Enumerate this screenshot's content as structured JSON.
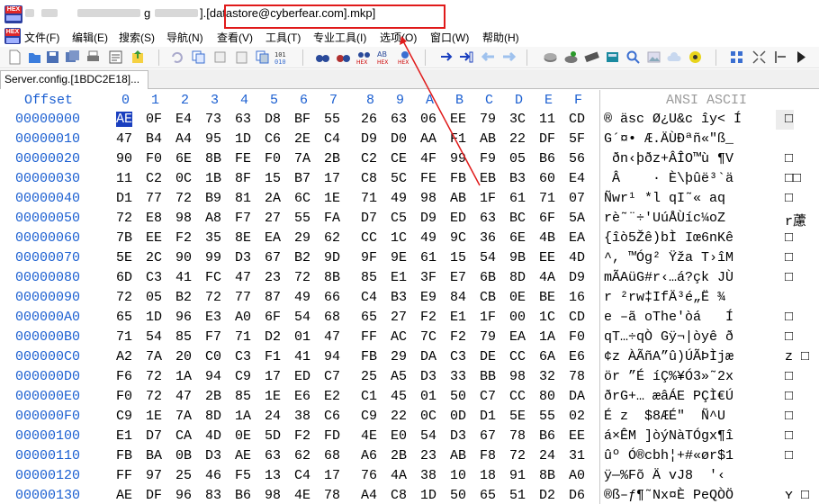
{
  "window": {
    "title_prefix": "g",
    "title_suffix": "].[datastore@cyberfear.com].mkp]",
    "title_bracket": "[",
    "icon": "hex-editor-app-icon"
  },
  "menu": [
    "文件(F)",
    "编辑(E)",
    "搜索(S)",
    "导航(N)",
    "查看(V)",
    "工具(T)",
    "专业工具(I)",
    "选项(O)",
    "窗口(W)",
    "帮助(H)"
  ],
  "toolbar": {
    "icons": [
      "new-file-icon",
      "open-file-icon",
      "save-icon",
      "save-all-icon",
      "print-icon",
      "properties-icon",
      "export-icon",
      "undo-icon",
      "copy-icon",
      "cut-icon",
      "paste-icon",
      "paste-special-icon",
      "bin-icon",
      "find-icon",
      "find-replace-icon",
      "find-hex-icon",
      "replace-hex-icon",
      "find-next-hex-icon",
      "goto-icon",
      "goto-offset-icon",
      "back-icon",
      "forward-icon",
      "disk-icon",
      "disk-open-icon",
      "ram-icon",
      "calculator-icon",
      "search-zoom-icon",
      "image-icon",
      "cloud-icon",
      "settings-gear-icon",
      "tools-icon",
      "run-icon"
    ],
    "accent": "#1b5fd1"
  },
  "tab": {
    "label": "Server.config.[1BDC2E18]..."
  },
  "editor": {
    "offset_header": "Offset",
    "columns": [
      "0",
      "1",
      "2",
      "3",
      "4",
      "5",
      "6",
      "7",
      "8",
      "9",
      "A",
      "B",
      "C",
      "D",
      "E",
      "F"
    ],
    "ansi_header": "ANSI ASCII",
    "rows": [
      {
        "off": "00000000",
        "bytes": [
          "AE",
          "0F",
          "E4",
          "73",
          "63",
          "D8",
          "BF",
          "55",
          "26",
          "63",
          "06",
          "EE",
          "79",
          "3C",
          "11",
          "CD"
        ],
        "ascii": "® äsc Ø¿U&c îy< Í",
        "pad": "□"
      },
      {
        "off": "00000010",
        "bytes": [
          "47",
          "B4",
          "A4",
          "95",
          "1D",
          "C6",
          "2E",
          "C4",
          "D9",
          "D0",
          "AA",
          "F1",
          "AB",
          "22",
          "DF",
          "5F"
        ],
        "ascii": "G´¤• Æ.ÄÙÐªñ«\"ß_",
        "pad": ""
      },
      {
        "off": "00000020",
        "bytes": [
          "90",
          "F0",
          "6E",
          "8B",
          "FE",
          "F0",
          "7A",
          "2B",
          "C2",
          "CE",
          "4F",
          "99",
          "F9",
          "05",
          "B6",
          "56"
        ],
        "ascii": " ðn‹þðz+ÂÎO™ù ¶V",
        "pad": "□"
      },
      {
        "off": "00000030",
        "bytes": [
          "11",
          "C2",
          "0C",
          "1B",
          "8F",
          "15",
          "B7",
          "17",
          "C8",
          "5C",
          "FE",
          "FB",
          "EB",
          "B3",
          "60",
          "E4"
        ],
        "ascii": " Â    · È\\þûë³`ä",
        "pad": "□□"
      },
      {
        "off": "00000040",
        "bytes": [
          "D1",
          "77",
          "72",
          "B9",
          "81",
          "2A",
          "6C",
          "1E",
          "71",
          "49",
          "98",
          "AB",
          "1F",
          "61",
          "71",
          "07"
        ],
        "ascii": "Ñwr¹ *l qI˜« aq",
        "pad": "□"
      },
      {
        "off": "00000050",
        "bytes": [
          "72",
          "E8",
          "98",
          "A8",
          "F7",
          "27",
          "55",
          "FA",
          "D7",
          "C5",
          "D9",
          "ED",
          "63",
          "BC",
          "6F",
          "5A"
        ],
        "ascii": "rè˜¨÷'UúÅÙíc¼oZ",
        "pad": "r藘"
      },
      {
        "off": "00000060",
        "bytes": [
          "7B",
          "EE",
          "F2",
          "35",
          "8E",
          "EA",
          "29",
          "62",
          "CC",
          "1C",
          "49",
          "9C",
          "36",
          "6E",
          "4B",
          "EA"
        ],
        "ascii": "{îò5Žê)bÌ Iœ6nKê",
        "pad": "□"
      },
      {
        "off": "00000070",
        "bytes": [
          "5E",
          "2C",
          "90",
          "99",
          "D3",
          "67",
          "B2",
          "9D",
          "9F",
          "9E",
          "61",
          "15",
          "54",
          "9B",
          "EE",
          "4D"
        ],
        "ascii": "^, ™Óg² Ÿža T›îM",
        "pad": "□"
      },
      {
        "off": "00000080",
        "bytes": [
          "6D",
          "C3",
          "41",
          "FC",
          "47",
          "23",
          "72",
          "8B",
          "85",
          "E1",
          "3F",
          "E7",
          "6B",
          "8D",
          "4A",
          "D9"
        ],
        "ascii": "mÃAüG#r‹…á?çk JÙ",
        "pad": "□"
      },
      {
        "off": "00000090",
        "bytes": [
          "72",
          "05",
          "B2",
          "72",
          "77",
          "87",
          "49",
          "66",
          "C4",
          "B3",
          "E9",
          "84",
          "CB",
          "0E",
          "BE",
          "16"
        ],
        "ascii": "r ²rw‡IfÄ³é„Ë ¾",
        "pad": ""
      },
      {
        "off": "000000A0",
        "bytes": [
          "65",
          "1D",
          "96",
          "E3",
          "A0",
          "6F",
          "54",
          "68",
          "65",
          "27",
          "F2",
          "E1",
          "1F",
          "00",
          "1C",
          "CD"
        ],
        "ascii": "e –ã oThe'òá   Í",
        "pad": "□"
      },
      {
        "off": "000000B0",
        "bytes": [
          "71",
          "54",
          "85",
          "F7",
          "71",
          "D2",
          "01",
          "47",
          "FF",
          "AC",
          "7C",
          "F2",
          "79",
          "EA",
          "1A",
          "F0"
        ],
        "ascii": "qT…÷qÒ Gÿ¬|òyê ð",
        "pad": "□"
      },
      {
        "off": "000000C0",
        "bytes": [
          "A2",
          "7A",
          "20",
          "C0",
          "C3",
          "F1",
          "41",
          "94",
          "FB",
          "29",
          "DA",
          "C3",
          "DE",
          "CC",
          "6A",
          "E6"
        ],
        "ascii": "¢z ÀÃñA”û)ÚÃÞÌjæ",
        "pad": "z □"
      },
      {
        "off": "000000D0",
        "bytes": [
          "F6",
          "72",
          "1A",
          "94",
          "C9",
          "17",
          "ED",
          "C7",
          "25",
          "A5",
          "D3",
          "33",
          "BB",
          "98",
          "32",
          "78"
        ],
        "ascii": "ör ”É íÇ%¥Ó3»˜2x",
        "pad": "□"
      },
      {
        "off": "000000E0",
        "bytes": [
          "F0",
          "72",
          "47",
          "2B",
          "85",
          "1E",
          "E6",
          "E2",
          "C1",
          "45",
          "01",
          "50",
          "C7",
          "CC",
          "80",
          "DA"
        ],
        "ascii": "ðrG+… æâÁE PÇÌ€Ú",
        "pad": "□"
      },
      {
        "off": "000000F0",
        "bytes": [
          "C9",
          "1E",
          "7A",
          "8D",
          "1A",
          "24",
          "38",
          "C6",
          "C9",
          "22",
          "0C",
          "0D",
          "D1",
          "5E",
          "55",
          "02"
        ],
        "ascii": "É z  $8ÆÉ\"  Ñ^U ",
        "pad": "□"
      },
      {
        "off": "00000100",
        "bytes": [
          "E1",
          "D7",
          "CA",
          "4D",
          "0E",
          "5D",
          "F2",
          "FD",
          "4E",
          "E0",
          "54",
          "D3",
          "67",
          "78",
          "B6",
          "EE"
        ],
        "ascii": "á×ÊM ]òýNàTÓgx¶î",
        "pad": "□"
      },
      {
        "off": "00000110",
        "bytes": [
          "FB",
          "BA",
          "0B",
          "D3",
          "AE",
          "63",
          "62",
          "68",
          "A6",
          "2B",
          "23",
          "AB",
          "F8",
          "72",
          "24",
          "31"
        ],
        "ascii": "ûº Ó®cbh¦+#«ør$1",
        "pad": "□"
      },
      {
        "off": "00000120",
        "bytes": [
          "FF",
          "97",
          "25",
          "46",
          "F5",
          "13",
          "C4",
          "17",
          "76",
          "4A",
          "38",
          "10",
          "18",
          "91",
          "8B",
          "A0"
        ],
        "ascii": "ÿ—%Fõ Ä vJ8  '‹ ",
        "pad": ""
      },
      {
        "off": "00000130",
        "bytes": [
          "AE",
          "DF",
          "96",
          "83",
          "B6",
          "98",
          "4E",
          "78",
          "A4",
          "C8",
          "1D",
          "50",
          "65",
          "51",
          "D2",
          "D6"
        ],
        "ascii": "®ß–ƒ¶˜Nx¤È PeQÒÖ",
        "pad": "ʏ □"
      }
    ],
    "selected_byte": {
      "row": 0,
      "col": 0
    },
    "highlight_color": "#e01a1a"
  }
}
